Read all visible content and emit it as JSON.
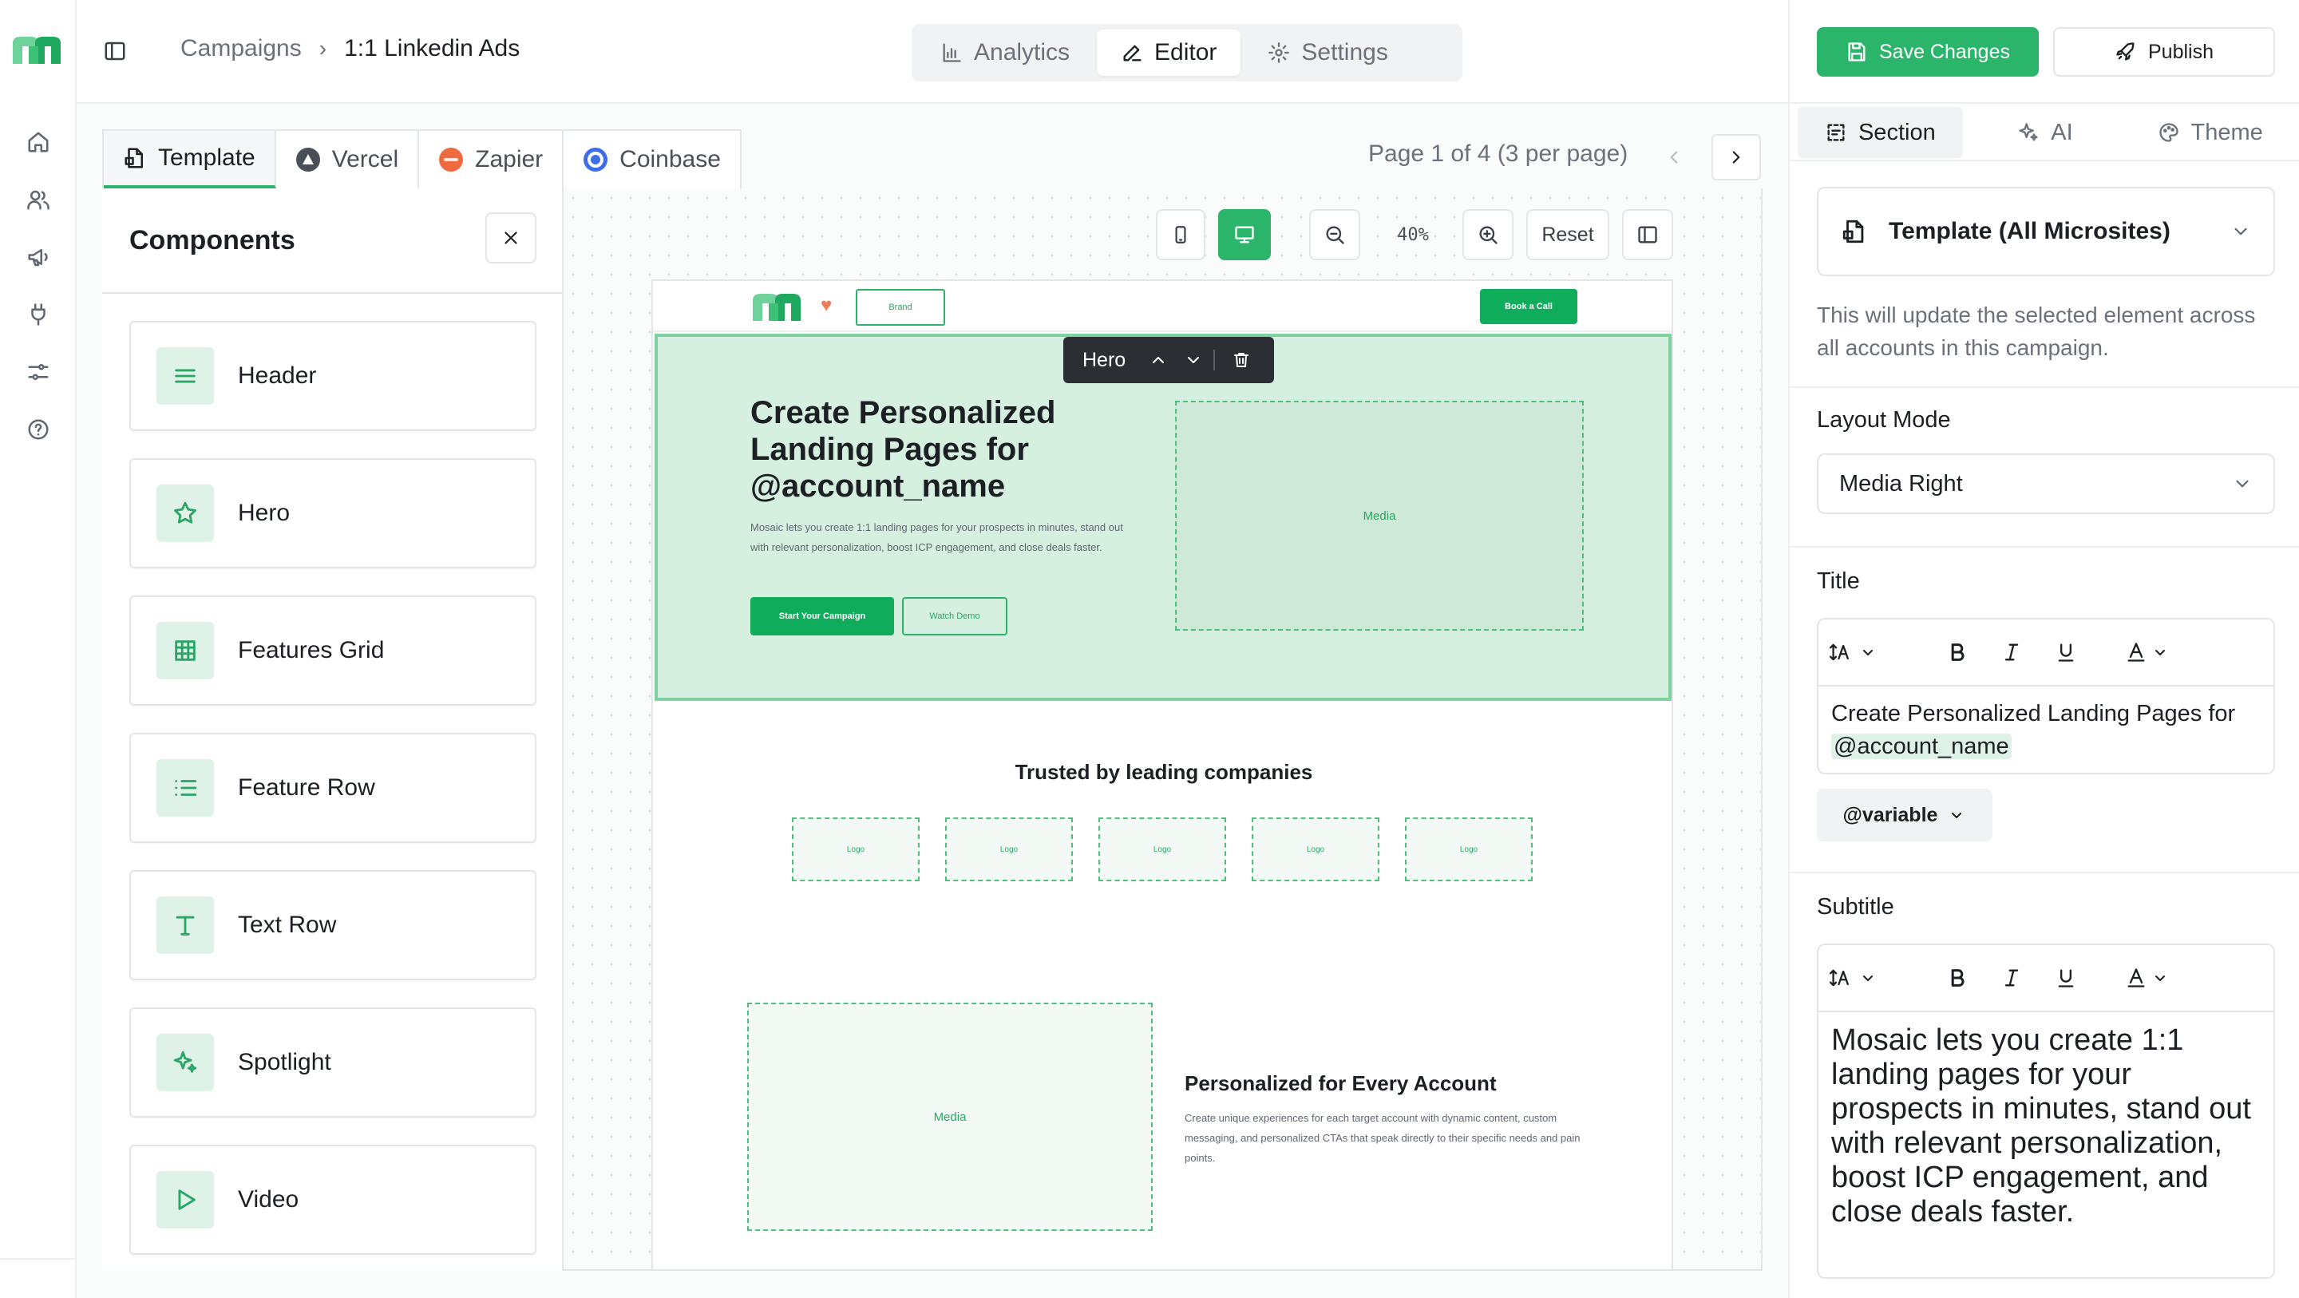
{
  "app": {
    "accent": "#2bb56a",
    "logo_icon": "mosaic-m-logo-icon"
  },
  "rail": {
    "items": [
      {
        "name": "home-icon"
      },
      {
        "name": "users-icon"
      },
      {
        "name": "megaphone-icon"
      },
      {
        "name": "plug-icon"
      },
      {
        "name": "sliders-icon"
      },
      {
        "name": "help-icon"
      }
    ]
  },
  "header": {
    "breadcrumb": [
      "Campaigns",
      "1:1 Linkedin Ads"
    ],
    "modes": [
      {
        "label": "Analytics",
        "icon": "bar-chart-icon"
      },
      {
        "label": "Editor",
        "icon": "pencil-icon",
        "active": true
      },
      {
        "label": "Settings",
        "icon": "gear-icon"
      }
    ]
  },
  "actions": {
    "save_label": "Save Changes",
    "publish_label": "Publish"
  },
  "tabs": {
    "items": [
      {
        "label": "Template",
        "icon": "template-file-icon",
        "active": true
      },
      {
        "label": "Vercel",
        "icon": "vercel-logo-icon",
        "color": "#4a4f57"
      },
      {
        "label": "Zapier",
        "icon": "zapier-logo-icon",
        "color": "#f06a3f"
      },
      {
        "label": "Coinbase",
        "icon": "coinbase-logo-icon",
        "color": "#3d6ee8"
      }
    ],
    "pager": "Page 1 of 4 (3 per page)"
  },
  "components": {
    "title": "Components",
    "items": [
      {
        "label": "Header",
        "icon": "menu-lines-icon"
      },
      {
        "label": "Hero",
        "icon": "star-icon"
      },
      {
        "label": "Features Grid",
        "icon": "grid-icon"
      },
      {
        "label": "Feature Row",
        "icon": "list-icon"
      },
      {
        "label": "Text Row",
        "icon": "text-t-icon"
      },
      {
        "label": "Spotlight",
        "icon": "sparkle-icon"
      },
      {
        "label": "Video",
        "icon": "play-icon"
      }
    ]
  },
  "canvas": {
    "zoom": "40%",
    "reset_label": "Reset"
  },
  "preview": {
    "brand": "Brand",
    "nav_cta": "Book a Call",
    "hero_toolbar_label": "Hero",
    "hero_title": "Create Personalized Landing Pages for @account_name",
    "hero_subtitle": "Mosaic lets you create 1:1 landing pages for your prospects in minutes, stand out with relevant personalization, boost ICP engagement, and close deals faster.",
    "hero_primary": "Start Your Campaign",
    "hero_secondary": "Watch Demo",
    "hero_media": "Media",
    "trusted_title": "Trusted by leading companies",
    "logos": [
      "Logo",
      "Logo",
      "Logo",
      "Logo",
      "Logo"
    ],
    "feature_media": "Media",
    "feature_title": "Personalized for Every Account",
    "feature_desc": "Create unique experiences for each target account with dynamic content, custom messaging, and personalized CTAs that speak directly to their specific needs and pain points."
  },
  "inspector": {
    "tabs": [
      {
        "label": "Section",
        "icon": "section-icon",
        "active": true
      },
      {
        "label": "AI",
        "icon": "sparkle-icon"
      },
      {
        "label": "Theme",
        "icon": "palette-icon"
      }
    ],
    "scope": "Template (All Microsites)",
    "scope_note": "This will update the selected element across all accounts in this campaign.",
    "layout_label": "Layout Mode",
    "layout_value": "Media Right",
    "title_label": "Title",
    "title_text": "Create Personalized Landing Pages for ",
    "title_var": "@account_name",
    "variable_label": "@variable",
    "subtitle_label": "Subtitle",
    "subtitle_text": "Mosaic lets you create 1:1 landing pages for your prospects in minutes, stand out with relevant personalization, boost ICP engagement, and close deals faster."
  }
}
